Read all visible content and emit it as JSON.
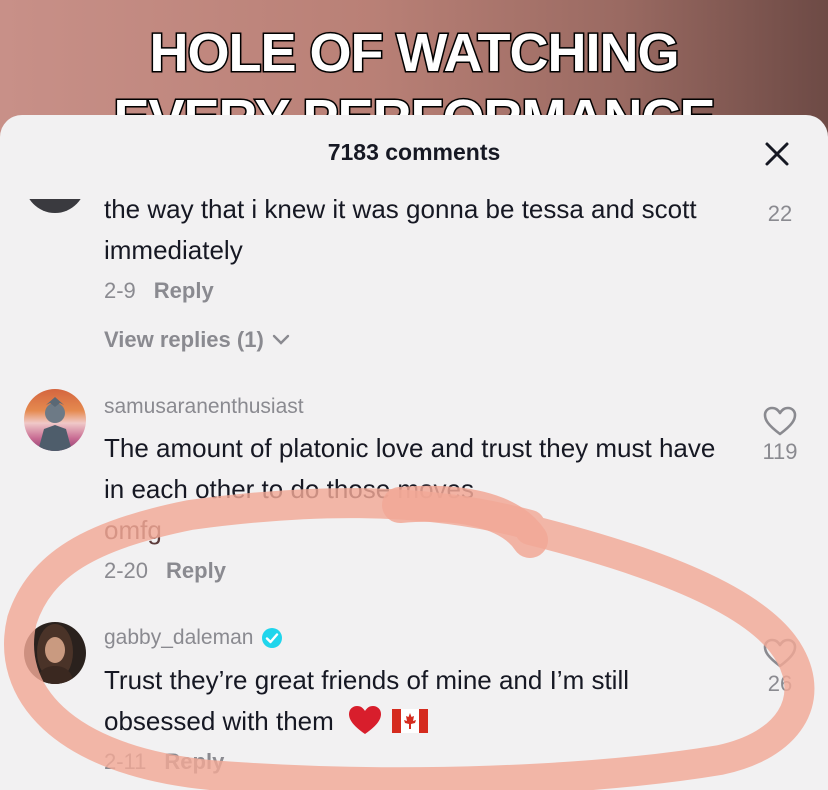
{
  "video": {
    "caption_line1": "HOLE OF WATCHING",
    "caption_line2": "EVERY PERFORMANCE"
  },
  "sheet": {
    "title": "7183 comments"
  },
  "comments": [
    {
      "username": "",
      "text": "the way that i knew it was gonna be tessa and scott immediately",
      "date": "2-9",
      "reply_label": "Reply",
      "likes": "22",
      "view_replies": "View replies (1)"
    },
    {
      "username": "samusaranenthusiast",
      "text_part1": "The amount of platonic love and trust they must have in each other to do those moves",
      "text_part2": "omfg",
      "date": "2-20",
      "reply_label": "Reply",
      "likes": "119"
    },
    {
      "username": "gabby_daleman",
      "verified": true,
      "text": "Trust they’re great friends of mine and I’m still obsessed with them",
      "emojis": [
        "red-heart",
        "canada-flag"
      ],
      "date": "2-11",
      "reply_label": "Reply",
      "likes": "26"
    }
  ],
  "colors": {
    "sheet_bg": "#f2f1f2",
    "text_primary": "#161823",
    "text_secondary": "#8a8a90",
    "verified_badge": "#20d5ec",
    "highlight_circle": "#f2a896"
  }
}
